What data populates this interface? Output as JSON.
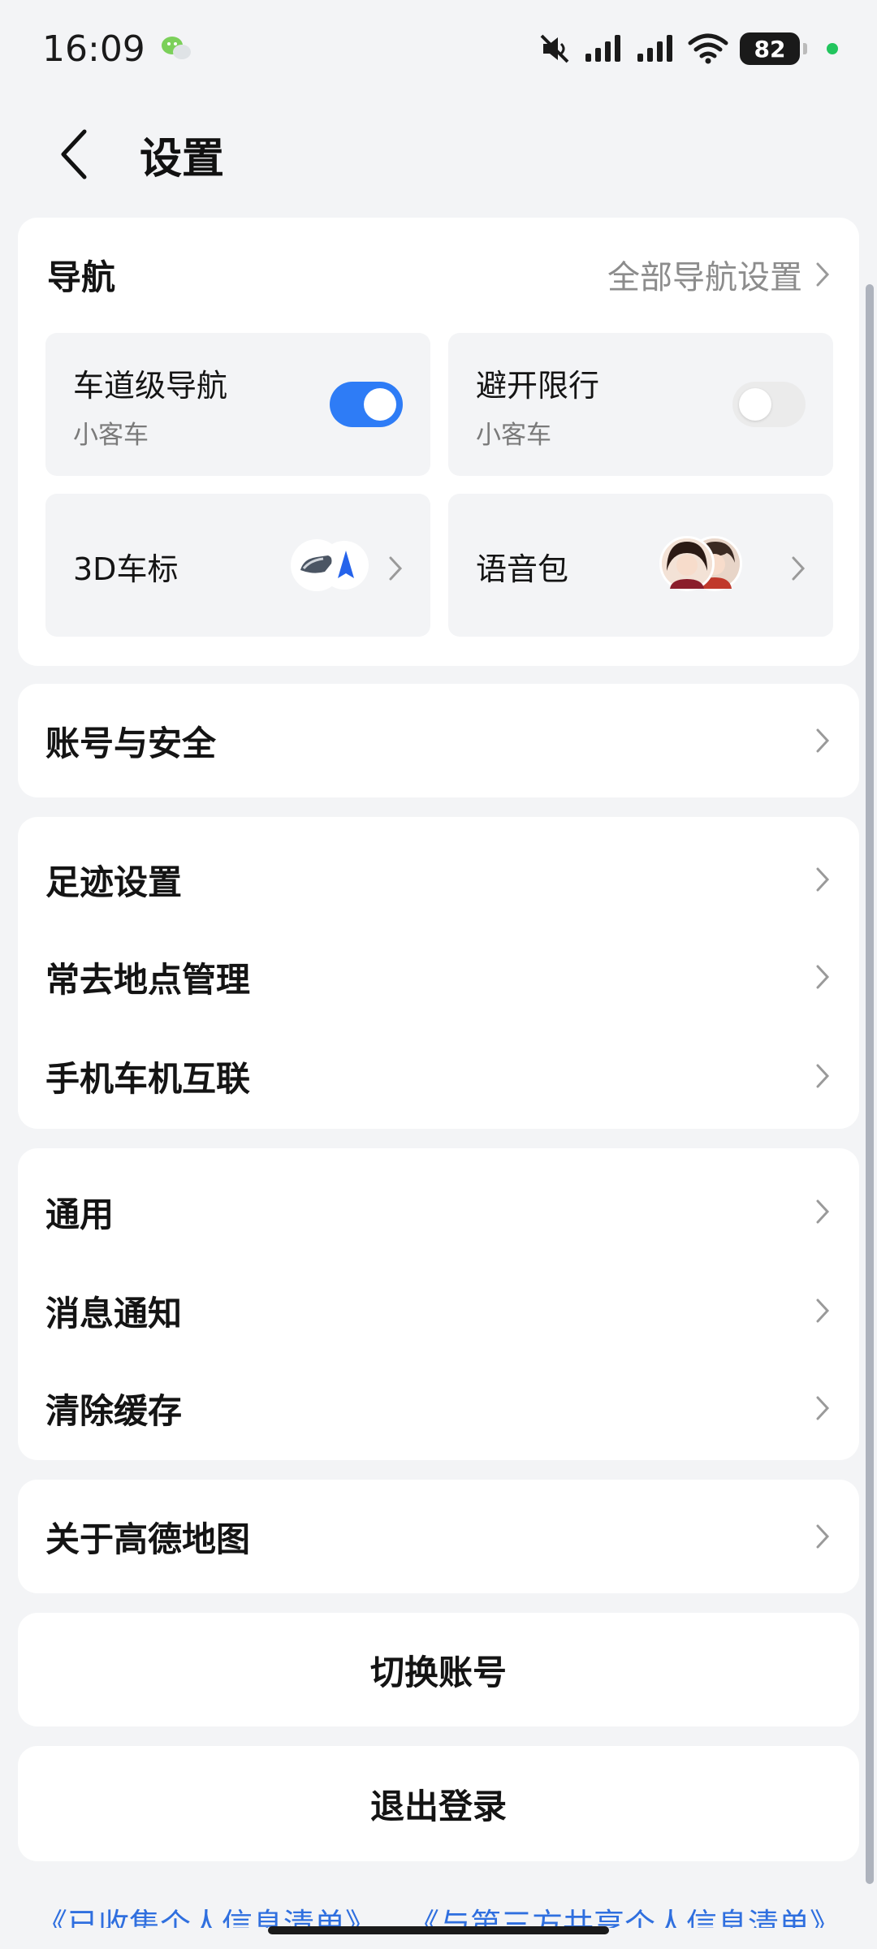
{
  "status_bar": {
    "time": "16:09",
    "battery": "82",
    "icons": [
      "wechat-icon",
      "mute-icon",
      "signal-icon",
      "signal-icon",
      "wifi-icon",
      "battery-icon"
    ]
  },
  "header": {
    "title": "设置"
  },
  "navigation": {
    "title": "导航",
    "all_settings": "全部导航设置",
    "tiles": [
      {
        "title": "车道级导航",
        "subtitle": "小客车",
        "toggle_on": true
      },
      {
        "title": "避开限行",
        "subtitle": "小客车",
        "toggle_on": false
      },
      {
        "title": "3D车标"
      },
      {
        "title": "语音包"
      }
    ]
  },
  "account_section": {
    "items": [
      "账号与安全"
    ]
  },
  "location_section": {
    "items": [
      "足迹设置",
      "常去地点管理",
      "手机车机互联"
    ]
  },
  "general_section": {
    "items": [
      "通用",
      "消息通知",
      "清除缓存"
    ]
  },
  "about_section": {
    "items": [
      "关于高德地图"
    ]
  },
  "buttons": {
    "switch_account": "切换账号",
    "logout": "退出登录"
  },
  "footer": {
    "links": [
      "《已收集个人信息清单》",
      "《与第三方共享个人信息清单》"
    ]
  },
  "colors": {
    "accent": "#2e7cf6",
    "background": "#f3f4f6",
    "link": "#2f6fdf"
  }
}
